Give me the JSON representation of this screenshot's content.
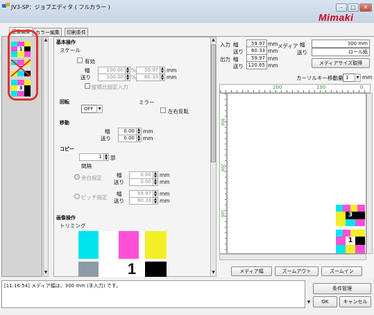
{
  "window": {
    "title": "JV3-SP：ジョブエディタ ( フルカラー )",
    "brand": "Mimaki",
    "min": "–",
    "max": "□",
    "close": "✕"
  },
  "tabs": [
    "画像編集",
    "カラー編集",
    "印刷条件"
  ],
  "thumbs": {
    "labels": [
      "1",
      "2",
      "3"
    ]
  },
  "basic": {
    "title": "基本操作",
    "scale": "スケール",
    "enable": "有効",
    "width_label": "幅",
    "feed_label": "送り",
    "w_pct": "100.00",
    "f_pct": "100.00",
    "pct": "%",
    "w_mm": "59.97",
    "f_mm": "60.33",
    "mm": "mm",
    "fixed_ratio": "縦横比固定入力"
  },
  "rotate": {
    "label": "回転",
    "value": "OFF"
  },
  "mirror": {
    "label": "ミラー",
    "option": "左右反転"
  },
  "move": {
    "label": "移動",
    "width_label": "幅",
    "feed_label": "送り",
    "w": "0.00",
    "f": "0.00",
    "mm": "mm"
  },
  "copy": {
    "label": "コピー",
    "count": "1",
    "unit": "部",
    "spacing": "間隔",
    "margin_opt": "余白指定",
    "pitch_opt": "ピッチ指定",
    "width_label": "幅",
    "feed_label": "送り",
    "m_w": "0.00",
    "m_f": "0.00",
    "p_w": "59.97",
    "p_f": "60.33",
    "mm": "mm"
  },
  "image_op": {
    "label": "画像操作",
    "trim": "トリミング",
    "number": "1"
  },
  "info": {
    "input": "入力",
    "output": "出力",
    "w": "幅",
    "f": "送り",
    "in_w": "59.97",
    "in_f": "60.33",
    "out_w": "59.97",
    "out_f": "120.65",
    "mm": "mm"
  },
  "media": {
    "label": "メディア",
    "w": "幅",
    "f": "送り",
    "w_val": "300 mm",
    "f_val": "ロール紙",
    "get": "メディアサイズ取得"
  },
  "cursor": {
    "label": "カーソルキー移動量",
    "value": "1",
    "unit": "mm"
  },
  "ruler": {
    "marks": [
      "200",
      "100",
      "0"
    ],
    "vmarks": [
      "300",
      "200",
      "100"
    ]
  },
  "bottom_btns": {
    "media_width": "メディア幅",
    "zoom_out": "ズームアウト",
    "zoom_in": "ズームイン"
  },
  "status": {
    "message": "[11:16:54] メディア幅は、300 mm (手入力) です。"
  },
  "actions": {
    "cond": "条件管理",
    "ok": "OK",
    "cancel": "キャンセル"
  },
  "colors": {
    "cyan": "#00e5f0",
    "magenta": "#ff4fd6",
    "yellow": "#f4ee27",
    "black": "#000000",
    "red": "#e3312f"
  }
}
